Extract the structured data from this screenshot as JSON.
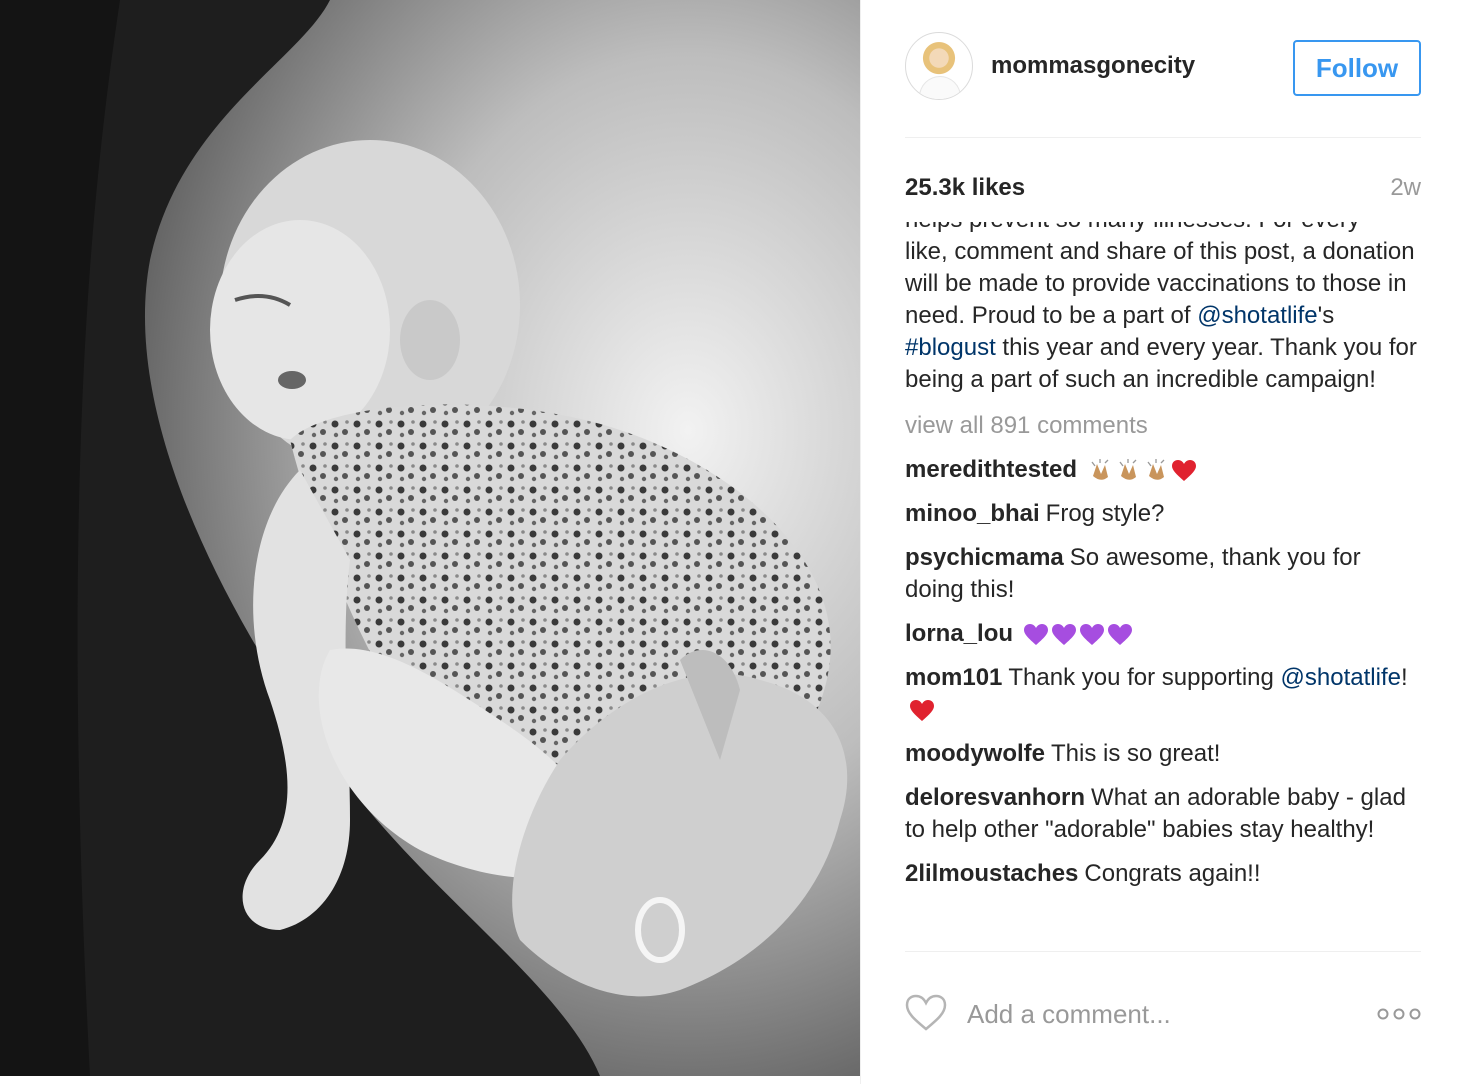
{
  "header": {
    "username": "mommasgonecity",
    "follow_label": "Follow"
  },
  "stats": {
    "likes": "25.3k likes",
    "age": "2w"
  },
  "caption": {
    "line_partial": "helps prevent so many illnesses. For every",
    "before_link1": "like, comment and share of this post, a donation will be made to provide vaccinations to those in need. Proud to be a part of ",
    "link1": "@shotatlife",
    "between": "'s ",
    "link2": "#blogust",
    "after": " this year and every year. Thank you for being a part of such an incredible campaign!"
  },
  "view_all_label": "view all 891 comments",
  "comments": [
    {
      "user": "meredithtested",
      "text": ""
    },
    {
      "user": "minoo_bhai",
      "text": "Frog style?"
    },
    {
      "user": "psychicmama",
      "text": "So awesome, thank you for doing this!"
    },
    {
      "user": "lorna_lou",
      "text": ""
    },
    {
      "user": "mom101",
      "text": "Thank you for supporting ",
      "link": "@shotatlife",
      "after": "!"
    },
    {
      "user": "moodywolfe",
      "text": "This is so great!"
    },
    {
      "user": "deloresvanhorn",
      "text": "What an adorable baby - glad to help other \"adorable\" babies stay healthy!"
    },
    {
      "user": "2lilmoustaches",
      "text": "Congrats again!!"
    }
  ],
  "footer": {
    "comment_placeholder": "Add a comment..."
  },
  "colors": {
    "follow_blue": "#3897f0",
    "link_blue": "#003569",
    "muted_gray": "#999999",
    "text_dark": "#262626"
  },
  "icons": {
    "like": "heart-outline-icon",
    "more": "more-options-icon",
    "clap": "clapping-hands-emoji",
    "red_heart": "red-heart-emoji",
    "purple_heart": "purple-heart-emoji"
  }
}
